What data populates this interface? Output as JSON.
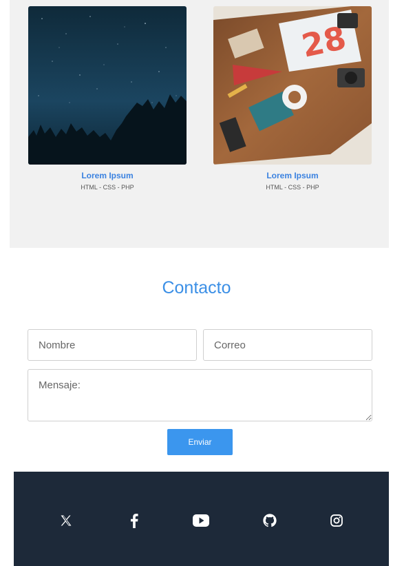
{
  "portfolio": {
    "items": [
      {
        "title": "Lorem Ipsum",
        "tags": "HTML - CSS - PHP",
        "image": "night-sky-forest-photo"
      },
      {
        "title": "Lorem Ipsum",
        "tags": "HTML - CSS - PHP",
        "image": "desk-flatlay-photo"
      }
    ]
  },
  "contact": {
    "title": "Contacto",
    "name_placeholder": "Nombre",
    "email_placeholder": "Correo",
    "message_placeholder": "Mensaje:",
    "submit_label": "Enviar"
  },
  "footer": {
    "social": [
      "x-icon",
      "facebook-icon",
      "youtube-icon",
      "github-icon",
      "instagram-icon"
    ]
  },
  "colors": {
    "accent": "#3b82e0",
    "button": "#3b96ee",
    "footer_bg": "#1d2939",
    "section_bg": "#f1f1f1"
  }
}
